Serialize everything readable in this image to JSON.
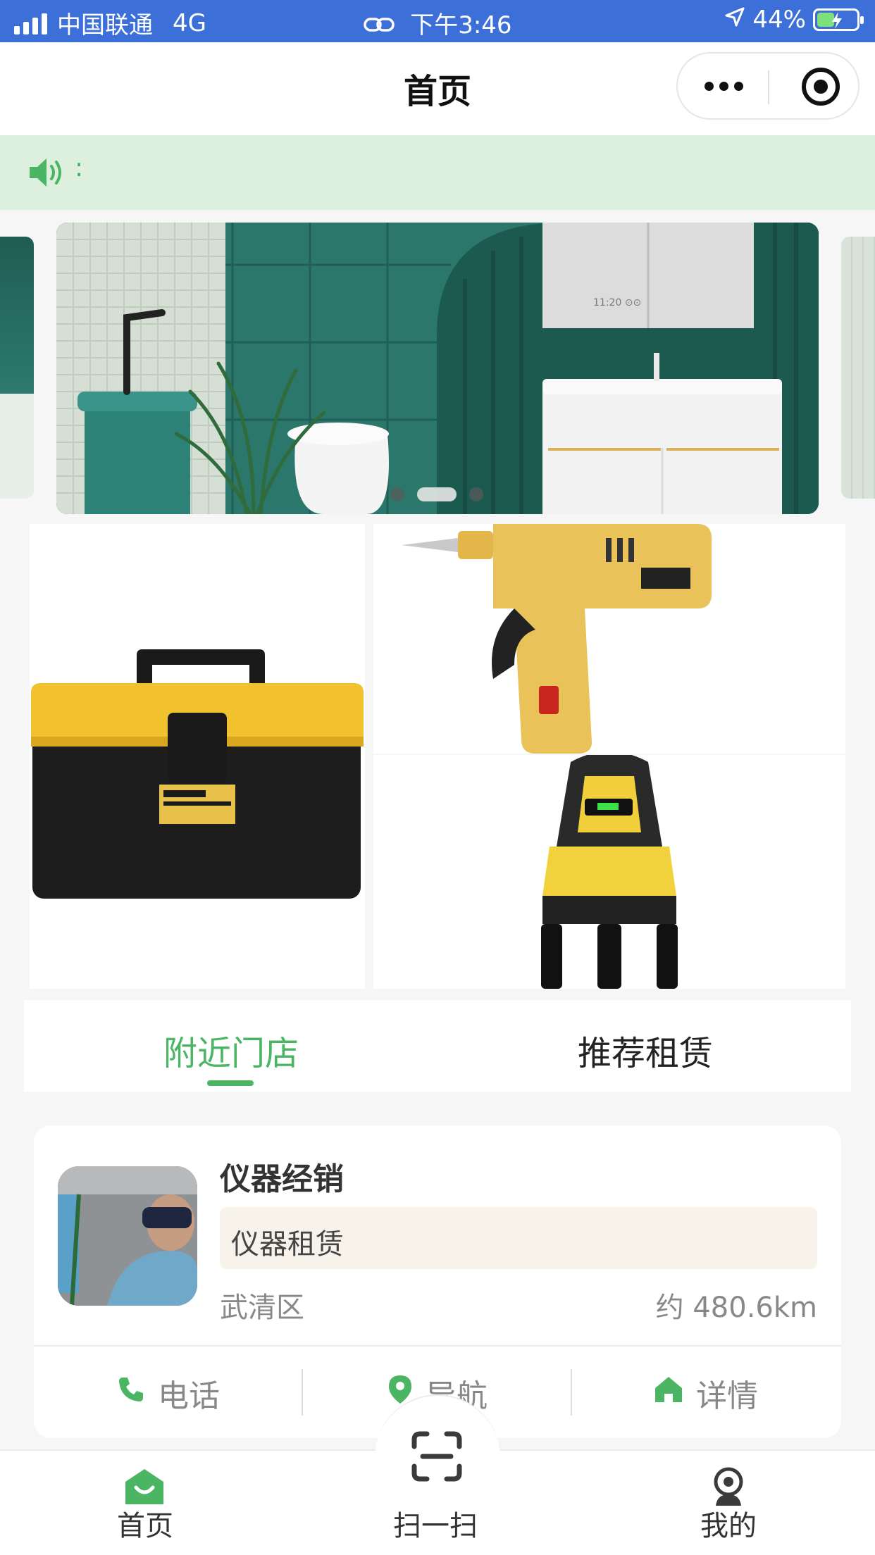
{
  "status_bar": {
    "carrier": "中国联通",
    "network": "4G",
    "time": "下午3:46",
    "battery": "44%",
    "battery_level": 0.44
  },
  "nav": {
    "title": "首页"
  },
  "notice": {
    "text": ":"
  },
  "banner": {
    "page_count": 3,
    "active_index": 1,
    "screen_text": "11:20 ⊙⊙"
  },
  "products": [
    {
      "name": "toolbox"
    },
    {
      "name": "glue-gun"
    },
    {
      "name": "laser-level"
    }
  ],
  "tabs": [
    {
      "label": "附近门店",
      "active": true
    },
    {
      "label": "推荐租赁",
      "active": false
    }
  ],
  "store": {
    "name": "仪器经销",
    "tag": "仪器租赁",
    "district": "武清区",
    "distance": "约 480.6km",
    "actions": {
      "phone": "电话",
      "navigate": "导航",
      "details": "详情"
    }
  },
  "tabbar": {
    "home": "首页",
    "scan": "扫一扫",
    "mine": "我的"
  },
  "colors": {
    "accent": "#4bb564",
    "status_bar": "#3d6fd8",
    "notice_bg": "#dcf0dd"
  }
}
